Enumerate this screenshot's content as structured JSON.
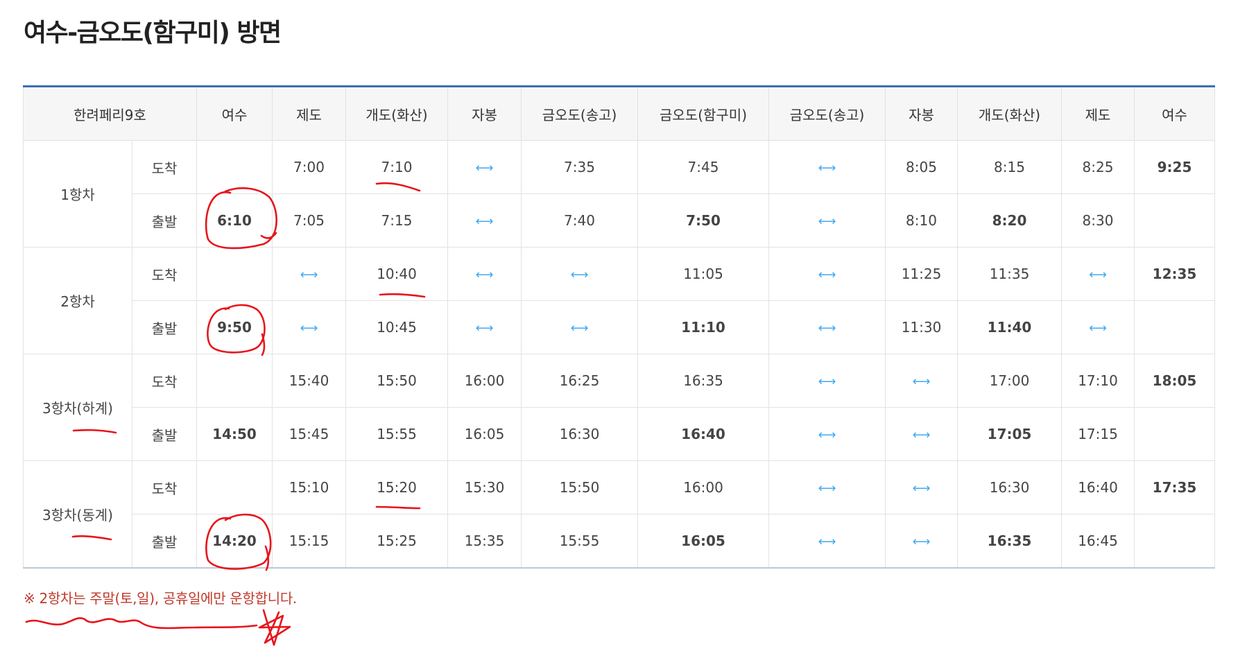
{
  "title": "여수-금오도(함구미) 방면",
  "table": {
    "corner_label": "한려페리9호",
    "stops": [
      "여수",
      "제도",
      "개도(화산)",
      "자봉",
      "금오도(송고)",
      "금오도(함구미)",
      "금오도(송고)",
      "자봉",
      "개도(화산)",
      "제도",
      "여수"
    ],
    "arrow_icon": "double-arrow-icon",
    "arrow_glyph": "⟷",
    "arrow_color": "#3fa9ee",
    "trips": [
      {
        "name": "1항차",
        "rows": [
          {
            "type": "도착",
            "cells": [
              "",
              "7:00",
              "7:10",
              "⟷",
              "7:35",
              "7:45",
              "⟷",
              "8:05",
              "8:15",
              "8:25",
              "9:25"
            ]
          },
          {
            "type": "출발",
            "cells": [
              "6:10",
              "7:05",
              "7:15",
              "⟷",
              "7:40",
              "7:50",
              "⟷",
              "8:10",
              "8:20",
              "8:30",
              ""
            ]
          }
        ]
      },
      {
        "name": "2항차",
        "rows": [
          {
            "type": "도착",
            "cells": [
              "",
              "⟷",
              "10:40",
              "⟷",
              "⟷",
              "11:05",
              "⟷",
              "11:25",
              "11:35",
              "⟷",
              "12:35"
            ]
          },
          {
            "type": "출발",
            "cells": [
              "9:50",
              "⟷",
              "10:45",
              "⟷",
              "⟷",
              "11:10",
              "⟷",
              "11:30",
              "11:40",
              "⟷",
              ""
            ]
          }
        ]
      },
      {
        "name": "3항차(하계)",
        "rows": [
          {
            "type": "도착",
            "cells": [
              "",
              "15:40",
              "15:50",
              "16:00",
              "16:25",
              "16:35",
              "⟷",
              "⟷",
              "17:00",
              "17:10",
              "18:05"
            ]
          },
          {
            "type": "출발",
            "cells": [
              "14:50",
              "15:45",
              "15:55",
              "16:05",
              "16:30",
              "16:40",
              "⟷",
              "⟷",
              "17:05",
              "17:15",
              ""
            ]
          }
        ]
      },
      {
        "name": "3항차(동계)",
        "rows": [
          {
            "type": "도착",
            "cells": [
              "",
              "15:10",
              "15:20",
              "15:30",
              "15:50",
              "16:00",
              "⟷",
              "⟷",
              "16:30",
              "16:40",
              "17:35"
            ]
          },
          {
            "type": "출발",
            "cells": [
              "14:20",
              "15:15",
              "15:25",
              "15:35",
              "15:55",
              "16:05",
              "⟷",
              "⟷",
              "16:35",
              "16:45",
              ""
            ]
          }
        ]
      }
    ]
  },
  "note": "※ 2항차는 주말(토,일), 공휴일에만 운항합니다.",
  "annotation_color": "#e8141b"
}
